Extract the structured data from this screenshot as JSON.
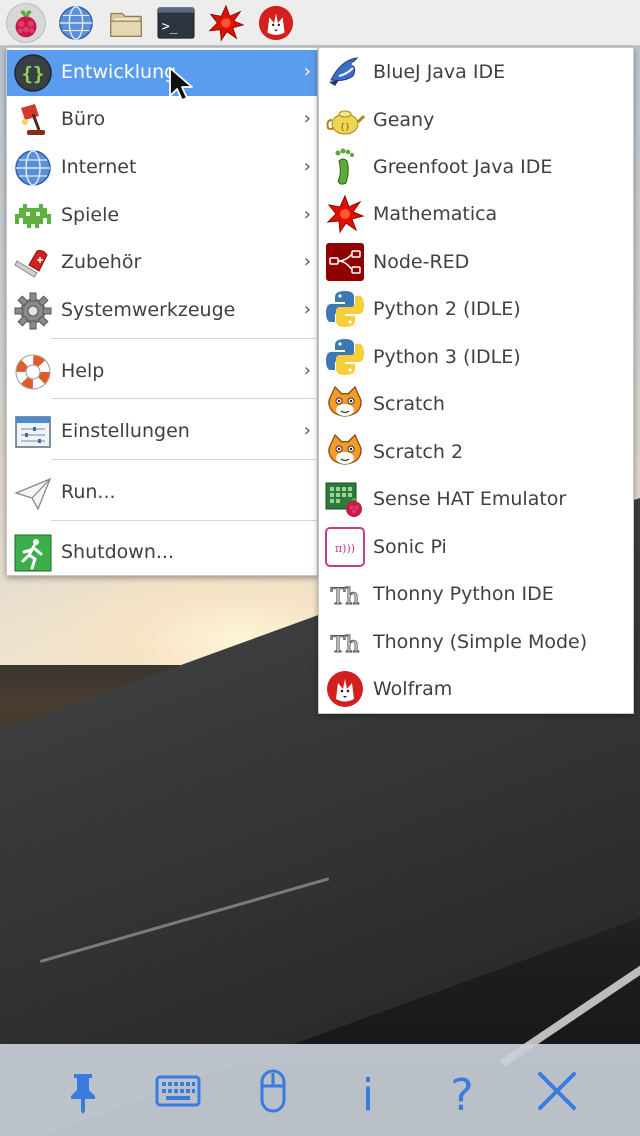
{
  "taskbar": {
    "launchers": [
      {
        "name": "raspberry-menu",
        "icon": "raspberry-icon"
      },
      {
        "name": "browser",
        "icon": "globe-icon"
      },
      {
        "name": "file-manager",
        "icon": "folder-icon"
      },
      {
        "name": "terminal",
        "icon": "terminal-icon"
      },
      {
        "name": "mathematica",
        "icon": "mathematica-icon"
      },
      {
        "name": "wolfram",
        "icon": "wolfram-icon"
      }
    ],
    "terminal_glyph": ">_"
  },
  "main_menu": {
    "items": [
      {
        "label": "Entwicklung",
        "icon": "braces-icon",
        "has_submenu": true,
        "selected": true
      },
      {
        "label": "Büro",
        "icon": "desk-lamp-icon",
        "has_submenu": true
      },
      {
        "label": "Internet",
        "icon": "globe-icon",
        "has_submenu": true
      },
      {
        "label": "Spiele",
        "icon": "space-invader-icon",
        "has_submenu": true
      },
      {
        "label": "Zubehör",
        "icon": "pocket-knife-icon",
        "has_submenu": true
      },
      {
        "label": "Systemwerkzeuge",
        "icon": "gear-icon",
        "has_submenu": true
      },
      {
        "label": "Help",
        "icon": "lifebuoy-icon",
        "has_submenu": true
      },
      {
        "label": "Einstellungen",
        "icon": "settings-sliders-icon",
        "has_submenu": true
      },
      {
        "label": "Run...",
        "icon": "paper-plane-icon",
        "has_submenu": false
      },
      {
        "label": "Shutdown...",
        "icon": "running-man-exit-icon",
        "has_submenu": false
      }
    ],
    "arrow": "›",
    "selected_color": "#5a9ced"
  },
  "submenu": {
    "items": [
      {
        "label": "BlueJ Java IDE",
        "icon": "bluej-bird-icon"
      },
      {
        "label": "Geany",
        "icon": "geany-teapot-icon"
      },
      {
        "label": "Greenfoot Java IDE",
        "icon": "greenfoot-footprint-icon"
      },
      {
        "label": "Mathematica",
        "icon": "mathematica-icon"
      },
      {
        "label": "Node-RED",
        "icon": "node-red-icon"
      },
      {
        "label": "Python 2 (IDLE)",
        "icon": "python-icon"
      },
      {
        "label": "Python 3 (IDLE)",
        "icon": "python-icon"
      },
      {
        "label": "Scratch",
        "icon": "scratch-cat-icon"
      },
      {
        "label": "Scratch 2",
        "icon": "scratch-cat-icon"
      },
      {
        "label": "Sense HAT Emulator",
        "icon": "sense-hat-icon"
      },
      {
        "label": "Sonic Pi",
        "icon": "sonic-pi-icon"
      },
      {
        "label": "Thonny Python IDE",
        "icon": "thonny-icon"
      },
      {
        "label": "Thonny (Simple Mode)",
        "icon": "thonny-icon"
      },
      {
        "label": "Wolfram",
        "icon": "wolfram-icon"
      }
    ],
    "icon_glyphs": {
      "sonic": "π)))",
      "thonny": "Th"
    }
  },
  "bottom_toolbar": {
    "buttons": [
      {
        "name": "pin",
        "icon": "pushpin-icon"
      },
      {
        "name": "keyboard",
        "icon": "keyboard-icon"
      },
      {
        "name": "mouse",
        "icon": "mouse-icon"
      },
      {
        "name": "info",
        "icon": "info-icon",
        "glyph": "i"
      },
      {
        "name": "help",
        "icon": "question-icon",
        "glyph": "?"
      },
      {
        "name": "close",
        "icon": "close-icon"
      }
    ],
    "icon_color": "#3a7be0"
  }
}
